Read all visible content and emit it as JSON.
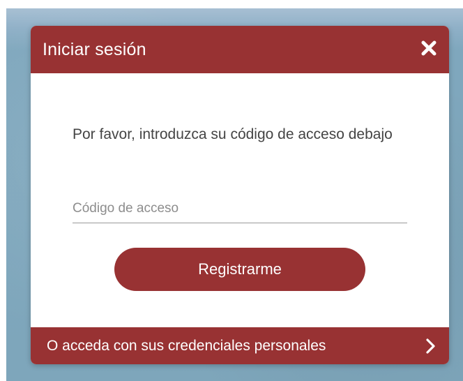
{
  "dialog": {
    "title": "Iniciar sesión",
    "close_icon": "close-icon",
    "prompt": "Por favor, introduzca su código de acceso debajo",
    "access_code": {
      "value": "",
      "placeholder": "Código de acceso"
    },
    "register_label": "Registrarme",
    "footer_label": "O acceda con sus credenciales personales",
    "footer_icon": "chevron-right-icon"
  },
  "colors": {
    "brand": "#983233",
    "backdrop": "#7ea6bb",
    "text": "#444444",
    "placeholder": "#8d8d8d"
  }
}
